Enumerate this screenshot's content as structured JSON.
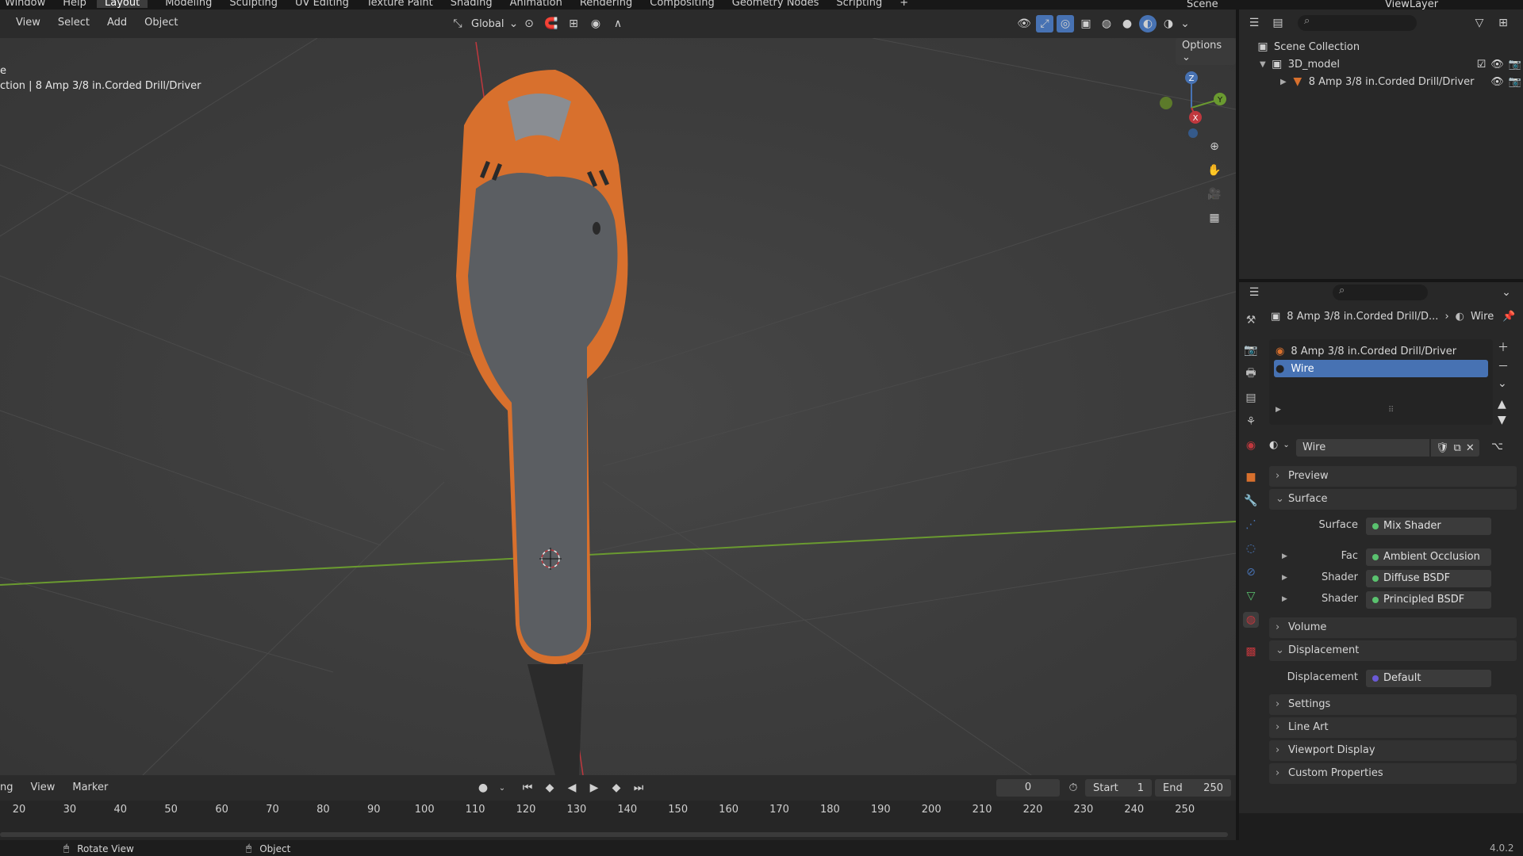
{
  "topbar": {
    "menu": [
      "Window",
      "Help"
    ],
    "tabs": [
      "Layout",
      "Modeling",
      "Sculpting",
      "UV Editing",
      "Texture Paint",
      "Shading",
      "Animation",
      "Rendering",
      "Compositing",
      "Geometry Nodes",
      "Scripting"
    ],
    "active_tab": "Layout",
    "add_tab": "+",
    "scene_name": "Scene",
    "viewlayer_name": "ViewLayer"
  },
  "viewport_header": {
    "menu": [
      "View",
      "Select",
      "Add",
      "Object"
    ],
    "transform_orientation": "Global",
    "options_label": "Options"
  },
  "viewport": {
    "overlay_line1": "e",
    "overlay_line2": "ction | 8 Amp 3/8 in.Corded Drill/Driver",
    "gizmo": {
      "z": "Z",
      "y": "Y",
      "x": "X"
    }
  },
  "outliner": {
    "root": "Scene Collection",
    "collection": "3D_model",
    "object": "8 Amp 3/8 in.Corded Drill/Driver"
  },
  "properties": {
    "breadcrumb_object": "8 Amp 3/8 in.Corded Drill/D...",
    "breadcrumb_material": "Wire",
    "material_slots": [
      "8 Amp 3/8 in.Corded Drill/Driver",
      "Wire"
    ],
    "selected_slot": "Wire",
    "material_name": "Wire",
    "sections": {
      "preview": "Preview",
      "surface": "Surface",
      "volume": "Volume",
      "displacement": "Displacement",
      "settings": "Settings",
      "line_art": "Line Art",
      "viewport_display": "Viewport Display",
      "custom_properties": "Custom Properties"
    },
    "surface_fields": [
      {
        "label": "Surface",
        "value": "Mix Shader"
      },
      {
        "label": "Fac",
        "value": "Ambient Occlusion"
      },
      {
        "label": "Shader",
        "value": "Diffuse BSDF"
      },
      {
        "label": "Shader",
        "value": "Principled BSDF"
      }
    ],
    "displacement_field": {
      "label": "Displacement",
      "value": "Default"
    }
  },
  "timeline": {
    "menu": [
      "ng",
      "View",
      "Marker"
    ],
    "current_frame": "0",
    "start_label": "Start",
    "start_value": "1",
    "end_label": "End",
    "end_value": "250",
    "ticks": [
      "20",
      "30",
      "40",
      "50",
      "60",
      "70",
      "80",
      "90",
      "100",
      "110",
      "120",
      "130",
      "140",
      "150",
      "160",
      "170",
      "180",
      "190",
      "200",
      "210",
      "220",
      "230",
      "240",
      "250"
    ]
  },
  "statusbar": {
    "left_action": "Rotate View",
    "mid_action": "Object",
    "version": "4.0.2"
  },
  "colors": {
    "accent_blue": "#4772b3",
    "drill_orange": "#d8702d",
    "drill_gray": "#5b5e62",
    "axis_green": "#6a9a30",
    "axis_red": "#c0383e"
  }
}
